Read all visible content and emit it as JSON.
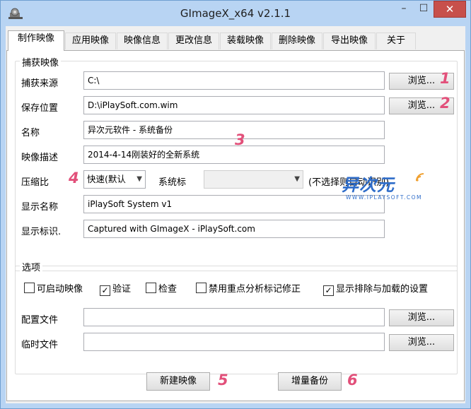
{
  "window": {
    "title": "GImageX_x64 v2.1.1",
    "icon": "gear-icon",
    "controls": {
      "minimize": "–",
      "maximize": "☐",
      "close": "✕"
    }
  },
  "tabs": [
    {
      "label": "制作映像",
      "active": true
    },
    {
      "label": "应用映像"
    },
    {
      "label": "映像信息"
    },
    {
      "label": "更改信息"
    },
    {
      "label": "装载映像"
    },
    {
      "label": "删除映像"
    },
    {
      "label": "导出映像"
    },
    {
      "label": "关于"
    }
  ],
  "capture": {
    "group_title": "捕获映像",
    "source_label": "捕获来源",
    "source_value": "C:\\",
    "save_label": "保存位置",
    "save_value": "D:\\iPlaySoft.com.wim",
    "browse_label": "浏览...",
    "name_label": "名称",
    "name_value": "异次元软件 - 系统备份",
    "desc_label": "映像描述",
    "desc_value": "2014-4-14刚装好的全新系统",
    "compress_label": "压缩比",
    "compress_value": "快速(默认",
    "sysflag_label": "系统标",
    "sysflag_value": "",
    "sysflag_hint": "(不选择则自动识别)",
    "display_name_label": "显示名称",
    "display_name_value": "iPlaySoft System v1",
    "display_flag_label": "显示标识.",
    "display_flag_value": "Captured with GImageX - iPlaySoft.com"
  },
  "options": {
    "group_title": "选项",
    "checkboxes": [
      {
        "label": "可启动映像",
        "checked": false
      },
      {
        "label": "验证",
        "checked": true
      },
      {
        "label": "检查",
        "checked": false
      },
      {
        "label": "禁用重点分析标记修正",
        "checked": false
      },
      {
        "label": "显示排除与加载的设置",
        "checked": true
      }
    ],
    "config_label": "配置文件",
    "config_value": "",
    "temp_label": "临时文件",
    "temp_value": "",
    "browse_label": "浏览..."
  },
  "actions": {
    "new_image": "新建映像",
    "incremental_backup": "增量备份"
  },
  "annotations": [
    "1",
    "2",
    "3",
    "4",
    "5",
    "6"
  ],
  "watermark": {
    "text": "异次元",
    "subtext": "WWW.IPLAYSOFT.COM",
    "color": "#2e6cc9"
  },
  "colors": {
    "annotation": "#e2507a",
    "titlebar": "#b8d4f3",
    "close_button": "#c7504b"
  }
}
